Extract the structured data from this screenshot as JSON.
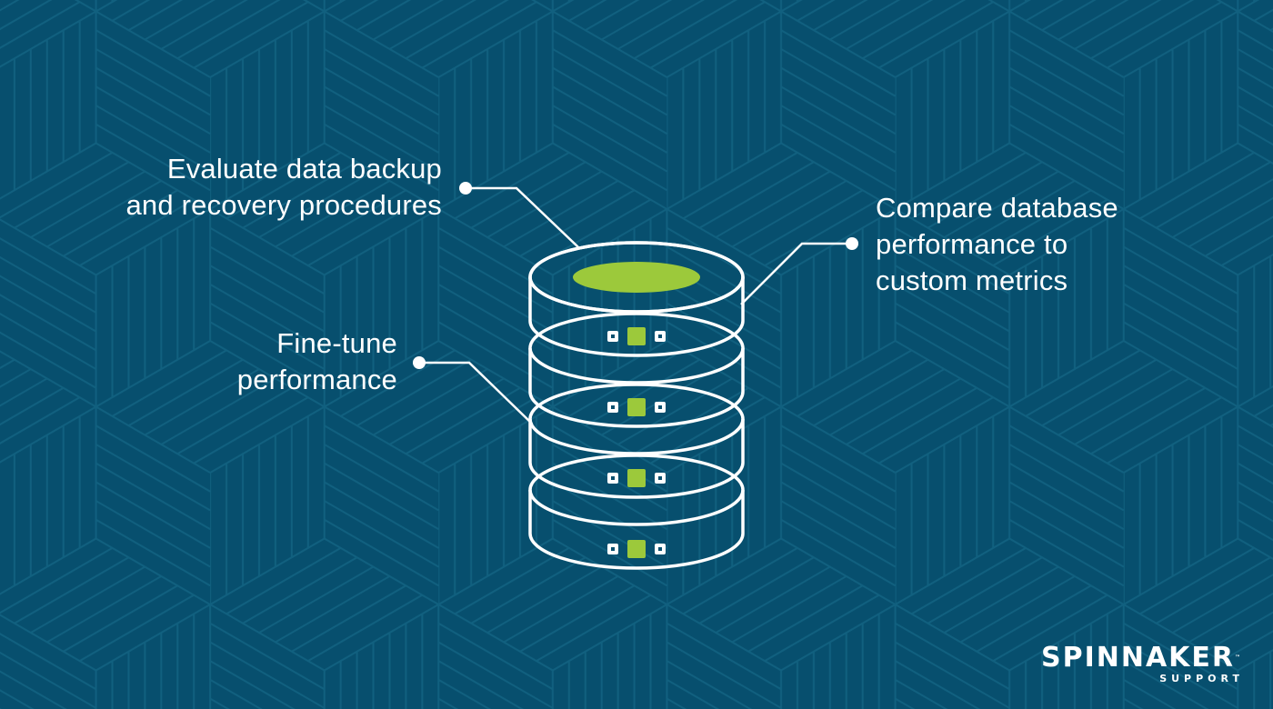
{
  "colors": {
    "background": "#074f6e",
    "pattern_line": "#11607f",
    "outline": "#ffffff",
    "accent_green": "#9cc93b"
  },
  "callouts": [
    {
      "id": "backup",
      "lines": [
        "Evaluate data backup",
        "and recovery procedures"
      ]
    },
    {
      "id": "compare",
      "lines": [
        "Compare database",
        "performance to",
        "custom metrics"
      ]
    },
    {
      "id": "tune",
      "lines": [
        "Fine-tune",
        "performance"
      ]
    }
  ],
  "database_icon": {
    "name": "database-stack-icon",
    "disk_count": 4
  },
  "logo": {
    "main": "SPINNAKER",
    "trademark": "™",
    "sub": "SUPPORT"
  }
}
